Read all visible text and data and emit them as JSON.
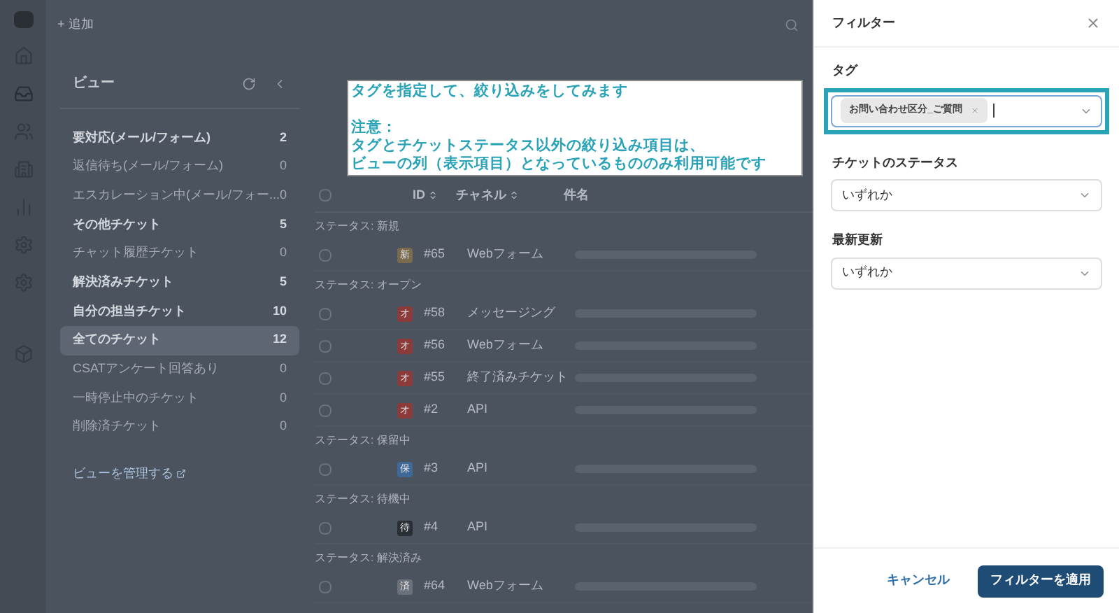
{
  "topbar": {
    "add_label": "+ 追加"
  },
  "views": {
    "title": "ビュー",
    "items": [
      {
        "label": "要対応(メール/フォーム)",
        "count": "2",
        "emphasized": true,
        "selected": false
      },
      {
        "label": "返信待ち(メール/フォーム)",
        "count": "0",
        "emphasized": false,
        "selected": false
      },
      {
        "label": "エスカレーション中(メール/フォー...",
        "count": "0",
        "emphasized": false,
        "selected": false
      },
      {
        "label": "その他チケット",
        "count": "5",
        "emphasized": true,
        "selected": false
      },
      {
        "label": "チャット履歴チケット",
        "count": "0",
        "emphasized": false,
        "selected": false
      },
      {
        "label": "解決済みチケット",
        "count": "5",
        "emphasized": true,
        "selected": false
      },
      {
        "label": "自分の担当チケット",
        "count": "10",
        "emphasized": true,
        "selected": false
      },
      {
        "label": "全てのチケット",
        "count": "12",
        "emphasized": true,
        "selected": true
      },
      {
        "label": "CSATアンケート回答あり",
        "count": "0",
        "emphasized": false,
        "selected": false
      },
      {
        "label": "一時停止中のチケット",
        "count": "0",
        "emphasized": false,
        "selected": false
      },
      {
        "label": "削除済チケット",
        "count": "0",
        "emphasized": false,
        "selected": false
      }
    ],
    "manage_link": "ビューを管理する"
  },
  "table": {
    "columns": [
      "ID",
      "チャネル",
      "件名"
    ],
    "select_all_checked": false,
    "groups": [
      {
        "label": "ステータス: 新規",
        "rows": [
          {
            "checked": false,
            "badge": "新",
            "color": "#7a6a50",
            "id": "#65",
            "channel": "Webフォーム"
          }
        ]
      },
      {
        "label": "ステータス: オープン",
        "rows": [
          {
            "checked": false,
            "badge": "オ",
            "color": "#8c3b3b",
            "id": "#58",
            "channel": "メッセージング"
          },
          {
            "checked": false,
            "badge": "オ",
            "color": "#8c3b3b",
            "id": "#56",
            "channel": "Webフォーム"
          },
          {
            "checked": false,
            "badge": "オ",
            "color": "#8c3b3b",
            "id": "#55",
            "channel": "終了済みチケット"
          },
          {
            "checked": false,
            "badge": "オ",
            "color": "#8c3b3b",
            "id": "#2",
            "channel": "API"
          }
        ]
      },
      {
        "label": "ステータス: 保留中",
        "rows": [
          {
            "checked": false,
            "badge": "保",
            "color": "#3f6a97",
            "id": "#3",
            "channel": "API"
          }
        ]
      },
      {
        "label": "ステータス: 待機中",
        "rows": [
          {
            "checked": false,
            "badge": "待",
            "color": "#2a2f36",
            "id": "#4",
            "channel": "API"
          }
        ]
      },
      {
        "label": "ステータス: 解決済み",
        "rows": [
          {
            "checked": false,
            "badge": "済",
            "color": "#6b717a",
            "id": "#64",
            "channel": "Webフォーム"
          }
        ]
      }
    ]
  },
  "annotation": {
    "heading": "タグを指定して、絞り込みをしてみます",
    "note_title": "注意：",
    "note_lines": [
      "タグとチケットステータス以外の絞り込み項目は、",
      "ビューの列（表示項目）となっているもののみ利用可能です"
    ]
  },
  "filter": {
    "title": "フィルター",
    "fields": [
      {
        "kind": "tags",
        "label": "タグ",
        "tags": [
          "お問い合わせ区分_ご質問"
        ],
        "highlighted": true
      },
      {
        "kind": "select",
        "label": "チケットのステータス",
        "value": "いずれか",
        "highlighted": false
      },
      {
        "kind": "select",
        "label": "最新更新",
        "value": "いずれか",
        "highlighted": false
      }
    ],
    "cancel": "キャンセル",
    "apply": "フィルターを適用"
  }
}
